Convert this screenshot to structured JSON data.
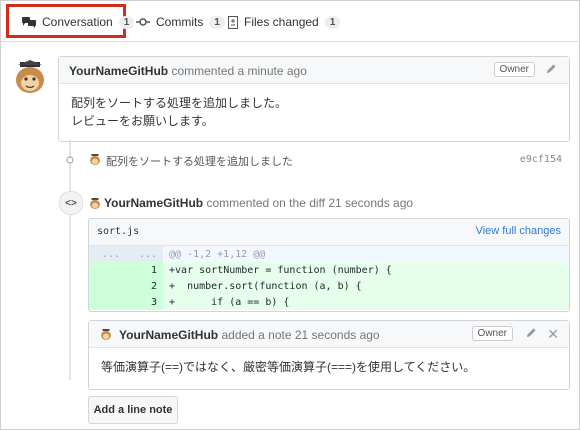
{
  "tabs": [
    {
      "label": "Conversation",
      "count": "1"
    },
    {
      "label": "Commits",
      "count": "1"
    },
    {
      "label": "Files changed",
      "count": "1"
    }
  ],
  "comment": {
    "author": "YourNameGitHub",
    "meta": "commented a minute ago",
    "badge": "Owner",
    "line1": "配列をソートする処理を追加しました。",
    "line2": "レビューをお願いします。"
  },
  "commit": {
    "message": "配列をソートする処理を追加しました",
    "sha": "e9cf154"
  },
  "diff_comment": {
    "author": "YourNameGitHub",
    "meta": "commented on the diff 21 seconds ago"
  },
  "file": {
    "name": "sort.js",
    "view_full": "View full changes",
    "hunk": "@@ -1,2 +1,12 @@",
    "dots_old": "...",
    "dots_new": "...",
    "lines": [
      {
        "num": "1",
        "prefix": "+",
        "code": "var sortNumber = function (number) {"
      },
      {
        "num": "2",
        "prefix": "+",
        "code": "  number.sort(function (a, b) {"
      },
      {
        "num": "3",
        "prefix": "+",
        "code": "      if (a == b) {"
      }
    ]
  },
  "note": {
    "author": "YourNameGitHub",
    "meta": "added a note 21 seconds ago",
    "badge": "Owner",
    "body": "等価演算子(==)ではなく、厳密等価演算子(===)を使用してください。"
  },
  "buttons": {
    "add_line_note": "Add a line note"
  },
  "colors": {
    "highlight": "#d02d1d",
    "link": "#2f7bd1",
    "add_bg": "#e6ffed"
  }
}
